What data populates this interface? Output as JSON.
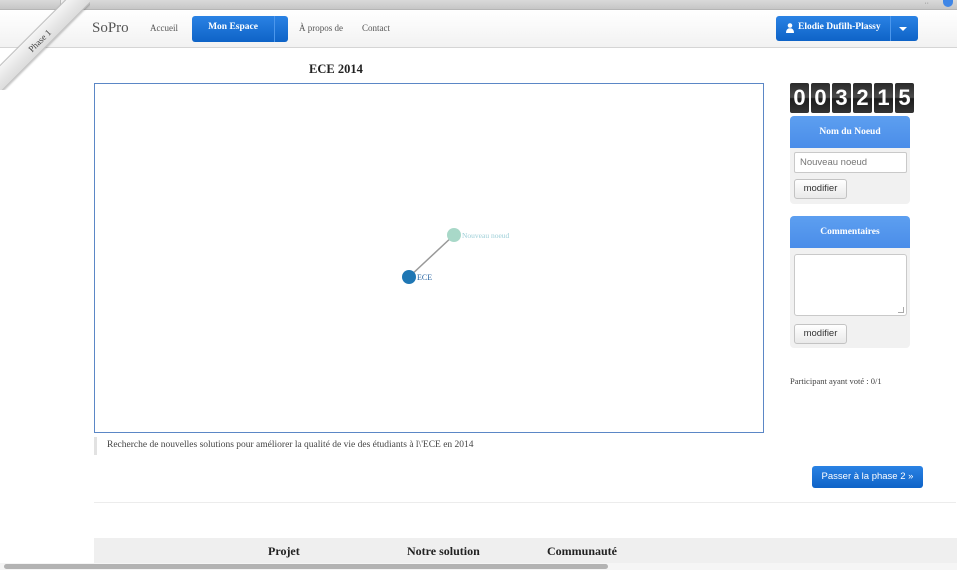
{
  "ribbon": {
    "label": "Phase 1"
  },
  "navbar": {
    "brand": "SoPro",
    "links": [
      "Accueil",
      "Mon Espace",
      "À propos de",
      "Contact"
    ],
    "user": "Elodie Dufilh-Plassy"
  },
  "graph": {
    "title": "ECE 2014",
    "nodes": [
      "ECE",
      "Nouveau noeud"
    ],
    "colors": {
      "root": "#1f77b4",
      "child": "#a8d8c8",
      "link": "#999999"
    }
  },
  "description": "Recherche de nouvelles solutions pour améliorer la qualité de vie des étudiants à l\\'ECE en 2014",
  "counter": [
    "0",
    "0",
    "3",
    "2",
    "1",
    "5"
  ],
  "node_panel": {
    "title": "Nom du Noeud",
    "input_placeholder": "Nouveau noeud",
    "button": "modifier"
  },
  "comment_panel": {
    "title": "Commentaires",
    "button": "modifier"
  },
  "vote_text": "Participant ayant voté : 0/1",
  "next_phase_button": "Passer à la phase 2 »",
  "footer": {
    "items": [
      "Projet",
      "Notre solution",
      "Communauté"
    ]
  },
  "theme": {
    "primary": "#1474d8",
    "panel_head": "#5598ee"
  }
}
